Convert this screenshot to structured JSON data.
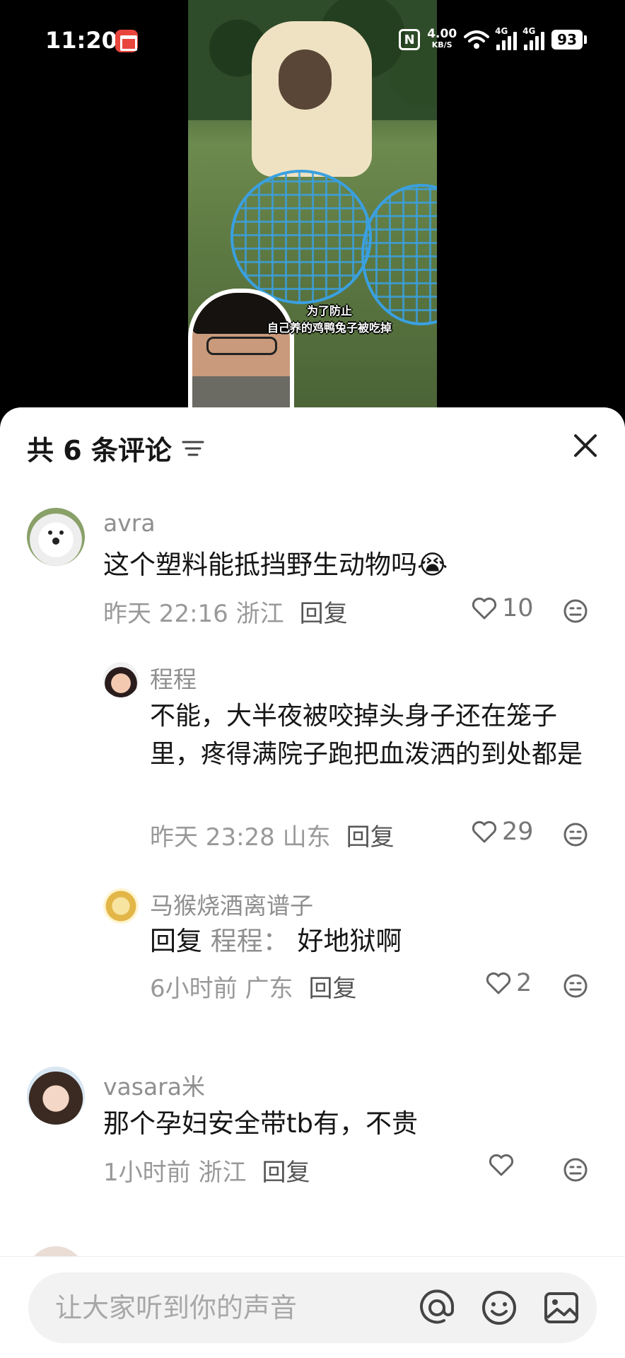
{
  "status_bar": {
    "time": "11:20",
    "nfc": "N",
    "net_speed": "4.00",
    "net_unit": "KB/S",
    "sim1": "4G",
    "sim2": "4G",
    "battery": "93"
  },
  "video": {
    "caption_line1": "为了防止",
    "caption_line2": "自己养的鸡鸭兔子被吃掉"
  },
  "sheet": {
    "title": "共 6 条评论"
  },
  "comments": [
    {
      "author": "avra",
      "text": "这个塑料能抵挡野生动物吗",
      "emoji": "😭",
      "time_loc": "昨天 22:16 浙江",
      "reply": "回复",
      "likes": "10"
    },
    {
      "author": "程程",
      "text": "不能，大半夜被咬掉头身子还在笼子里，疼得满院子跑把血泼洒的到处都是",
      "time_loc": "昨天 23:28 山东",
      "reply": "回复",
      "likes": "29"
    },
    {
      "author": "马猴烧酒离谱子",
      "reply_prefix": "回复",
      "reply_target": "程程：",
      "text": "好地狱啊",
      "time_loc": "6小时前 广东",
      "reply": "回复",
      "likes": "2"
    },
    {
      "author": "vasara米",
      "text": "那个孕妇安全带tb有，不贵",
      "time_loc": "1小时前 浙江",
      "reply": "回复",
      "likes": ""
    }
  ],
  "input": {
    "placeholder": "让大家听到你的声音"
  },
  "colors": {
    "accent_blue": "#3aa0e0",
    "text_primary": "#161616",
    "text_secondary": "#8f8f8f"
  }
}
